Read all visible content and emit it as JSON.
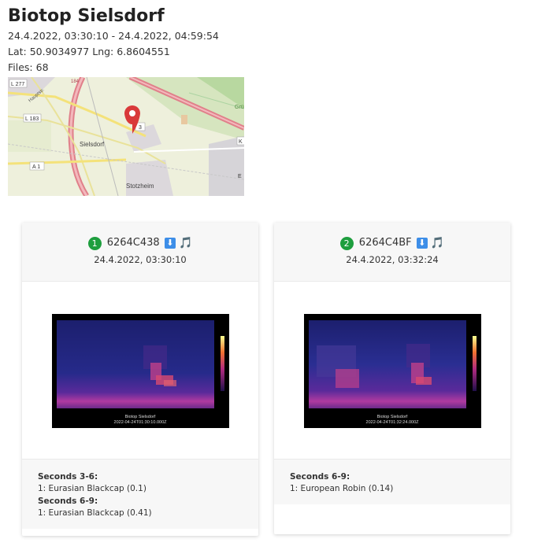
{
  "page": {
    "title": "Biotop Sielsdorf",
    "date_range": "24.4.2022, 03:30:10 - 24.4.2022, 04:59:54",
    "coords": "Lat: 50.9034977 Lng: 6.8604551",
    "files": "Files: 68"
  },
  "map": {
    "labels": {
      "l277": "L 277",
      "l183": "L 183",
      "a1": "A 1",
      "sielsdorf": "Sielsdorf",
      "stotzheim": "Stotzheim",
      "l_short": "3",
      "gr": "Grü",
      "k": "K",
      "e": "E",
      "route": "184",
      "hauptstr": "Hauptstr."
    },
    "marker_icon": "map-pin-icon"
  },
  "cards": [
    {
      "index": "1",
      "id": "6264C438",
      "download_icon": "⬇",
      "note_icon": "🎵",
      "datetime": "24.4.2022, 03:30:10",
      "spectro_caption_1": "Biotop Sielsdorf",
      "spectro_caption_2": "2022-04-24T01:30:10.000Z",
      "segments": [
        {
          "title": "Seconds 3-6:",
          "item": "1: Eurasian Blackcap (0.1)"
        },
        {
          "title": "Seconds 6-9:",
          "item": "1: Eurasian Blackcap (0.41)"
        }
      ]
    },
    {
      "index": "2",
      "id": "6264C4BF",
      "download_icon": "⬇",
      "note_icon": "🎵",
      "datetime": "24.4.2022, 03:32:24",
      "spectro_caption_1": "Biotop Sielsdorf",
      "spectro_caption_2": "2022-04-24T01:32:24.000Z",
      "segments": [
        {
          "title": "Seconds 6-9:",
          "item": "1: European Robin (0.14)"
        }
      ]
    }
  ],
  "colors": {
    "badge": "#1e9e3e",
    "accent": "#3d8ee8",
    "marker": "#d9393a"
  }
}
